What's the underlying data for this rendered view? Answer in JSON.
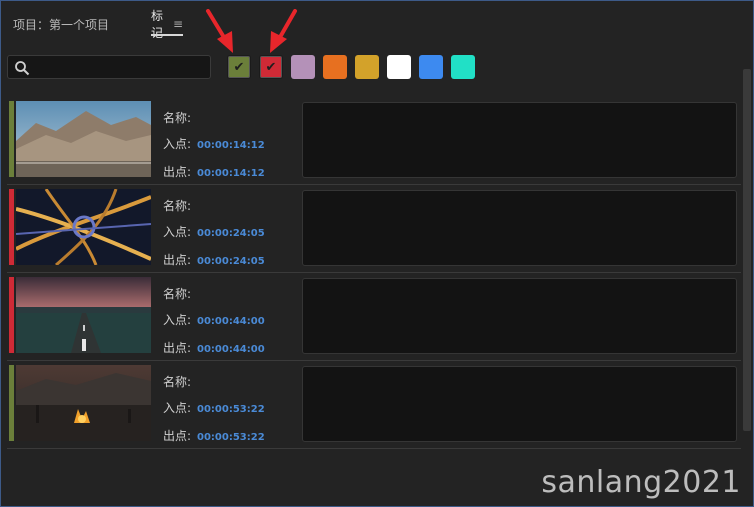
{
  "header": {
    "project_label": "项目：第一个项目",
    "tab_label": "标记",
    "tab_menu_icon": "≡"
  },
  "search": {
    "placeholder": "",
    "value": ""
  },
  "colors": {
    "olive": "#6b7f3a",
    "red": "#cf2a36",
    "lavender": "#b491b8",
    "orange": "#e77020",
    "gold": "#d3a22a",
    "white": "#ffffff",
    "blue": "#3d8af0",
    "teal": "#21e0c6",
    "timecode": "#4a8ad6"
  },
  "swatches": [
    {
      "name": "olive",
      "checked": true
    },
    {
      "name": "red",
      "checked": true
    },
    {
      "name": "lavender",
      "checked": false
    },
    {
      "name": "orange",
      "checked": false
    },
    {
      "name": "gold",
      "checked": false
    },
    {
      "name": "white",
      "checked": false
    },
    {
      "name": "blue",
      "checked": false
    },
    {
      "name": "teal",
      "checked": false
    }
  ],
  "markers": [
    {
      "color": "olive",
      "name_label": "名称:",
      "in_label": "入点:",
      "in_tc": "00:00:14:12",
      "out_label": "出点:",
      "out_tc": "00:00:14:12",
      "thumb": "desert-mountains"
    },
    {
      "color": "red",
      "name_label": "名称:",
      "in_label": "入点:",
      "in_tc": "00:00:24:05",
      "out_label": "出点:",
      "out_tc": "00:00:24:05",
      "thumb": "highway-interchange-night"
    },
    {
      "color": "red",
      "name_label": "名称:",
      "in_label": "入点:",
      "in_tc": "00:00:44:00",
      "out_label": "出点:",
      "out_tc": "00:00:44:00",
      "thumb": "road-dusk"
    },
    {
      "color": "olive",
      "name_label": "名称:",
      "in_label": "入点:",
      "in_tc": "00:00:53:22",
      "out_label": "出点:",
      "out_tc": "00:00:53:22",
      "thumb": "campfire-night"
    }
  ],
  "watermark": "sanlang2021"
}
